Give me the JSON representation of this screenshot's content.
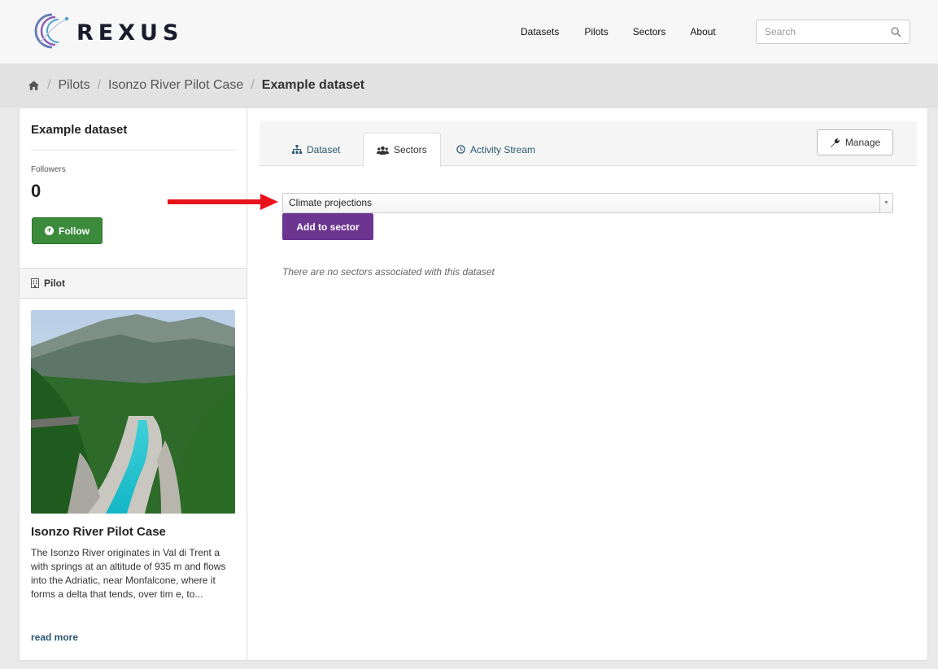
{
  "brand": {
    "name": "REXUS"
  },
  "nav": {
    "items": [
      "Datasets",
      "Pilots",
      "Sectors",
      "About"
    ]
  },
  "search": {
    "placeholder": "Search"
  },
  "breadcrumb": {
    "items": [
      "Pilots",
      "Isonzo River Pilot Case"
    ],
    "current": "Example dataset"
  },
  "sidebar": {
    "title": "Example dataset",
    "followers_label": "Followers",
    "followers_count": "0",
    "follow_label": "Follow",
    "pilot_heading": "Pilot",
    "pilot_name": "Isonzo River Pilot Case",
    "pilot_description": "The Isonzo River originates in Val di Trent a with springs at an altitude of 935 m and flows into the Adriatic, near Monfalcone, where it forms a delta that tends, over tim e, to...",
    "read_more": "read more"
  },
  "tabs": [
    {
      "label": "Dataset",
      "icon": "sitemap-icon",
      "active": false
    },
    {
      "label": "Sectors",
      "icon": "users-icon",
      "active": true
    },
    {
      "label": "Activity Stream",
      "icon": "clock-icon",
      "active": false
    }
  ],
  "manage_label": "Manage",
  "sector_select": {
    "selected": "Climate projections"
  },
  "add_sector_label": "Add to sector",
  "empty_message": "There are no sectors associated with this dataset",
  "colors": {
    "follow": "#3c8b3c",
    "add_sector": "#6b3590",
    "link": "#2b5873",
    "annotation_arrow": "#e8121b"
  }
}
